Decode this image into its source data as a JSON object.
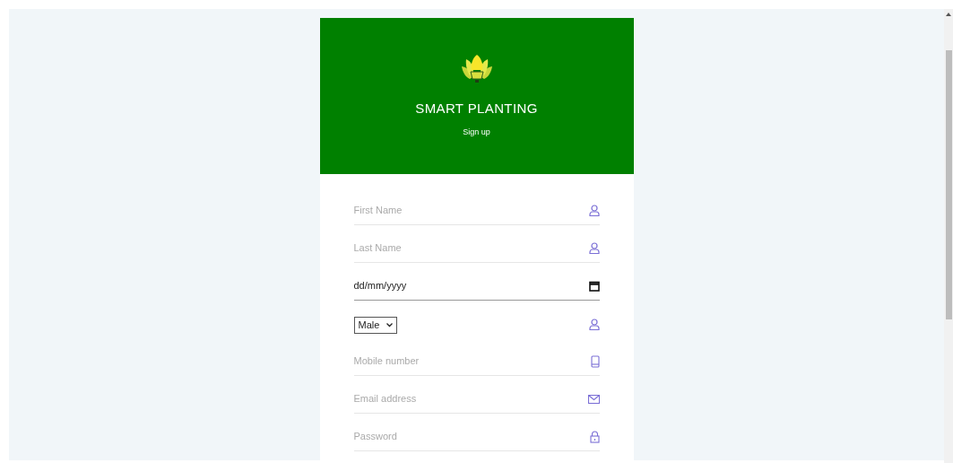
{
  "header": {
    "title": "SMART PLANTING",
    "subtitle": "Sign up"
  },
  "fields": [
    {
      "kind": "text",
      "placeholder": "First Name"
    },
    {
      "kind": "text",
      "placeholder": "Last Name"
    },
    {
      "kind": "date",
      "value": "dd/mm/yyyy"
    },
    {
      "kind": "select",
      "value": "Male"
    },
    {
      "kind": "text",
      "placeholder": "Mobile number"
    },
    {
      "kind": "text",
      "placeholder": "Email address"
    },
    {
      "kind": "text",
      "placeholder": "Password"
    }
  ]
}
